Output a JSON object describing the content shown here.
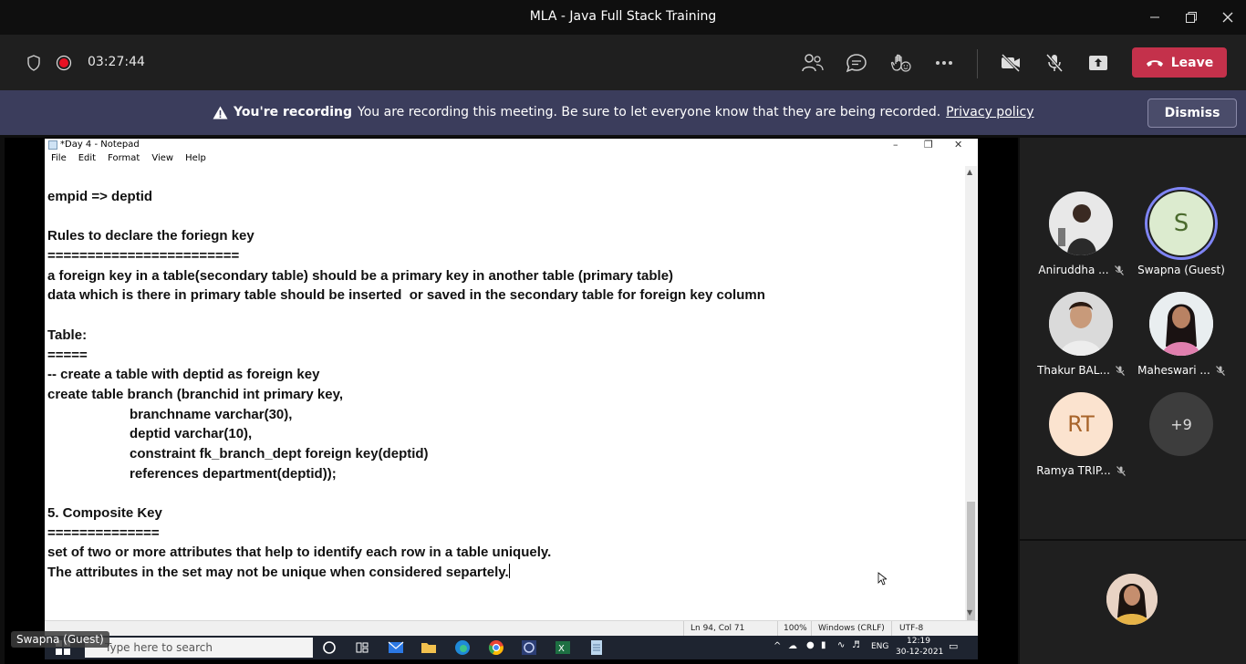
{
  "window": {
    "title": "MLA - Java Full Stack Training"
  },
  "toolbar": {
    "timer": "03:27:44",
    "leave_label": "Leave",
    "colors": {
      "leave": "#c4314b",
      "record_dot": "#e81123"
    }
  },
  "banner": {
    "heading": "You're recording",
    "message": "You are recording this meeting. Be sure to let everyone know that they are being recorded.",
    "link": "Privacy policy",
    "dismiss_label": "Dismiss"
  },
  "notepad": {
    "title": "*Day 4 - Notepad",
    "menu": [
      "File",
      "Edit",
      "Format",
      "View",
      "Help"
    ],
    "lines": [
      "empid => deptid",
      "",
      "Rules to declare the foriegn key",
      "========================",
      "a foreign key in a table(secondary table) should be a primary key in another table (primary table)",
      "data which is there in primary table should be inserted  or saved in the secondary table for foreign key column",
      "",
      "Table:",
      "=====",
      "-- create a table with deptid as foreign key",
      "create table branch (branchid int primary key,",
      "branchname varchar(30),",
      "deptid varchar(10),",
      "constraint fk_branch_dept foreign key(deptid)",
      "references department(deptid));",
      "",
      "5. Composite Key",
      "==============",
      "set of two or more attributes that help to identify each row in a table uniquely.",
      "The attributes in the set may not be unique when considered separtely."
    ],
    "status": {
      "position": "Ln 94, Col 71",
      "zoom": "100%",
      "line_ending": "Windows (CRLF)",
      "encoding": "UTF-8"
    }
  },
  "taskbar": {
    "search_placeholder": "Type here to search",
    "language": "ENG",
    "time": "12:19",
    "date": "30-12-2021"
  },
  "self_label": "Swapna (Guest)",
  "participants": [
    {
      "name": "Aniruddha ...",
      "initials": "",
      "muted": true
    },
    {
      "name": "Swapna (Guest)",
      "initials": "S",
      "muted": false
    },
    {
      "name": "Thakur BAL...",
      "initials": "",
      "muted": true
    },
    {
      "name": "Maheswari ...",
      "initials": "",
      "muted": true
    },
    {
      "name": "Ramya TRIP...",
      "initials": "RT",
      "muted": true
    },
    {
      "name": "",
      "initials": "+9",
      "muted": false
    }
  ]
}
